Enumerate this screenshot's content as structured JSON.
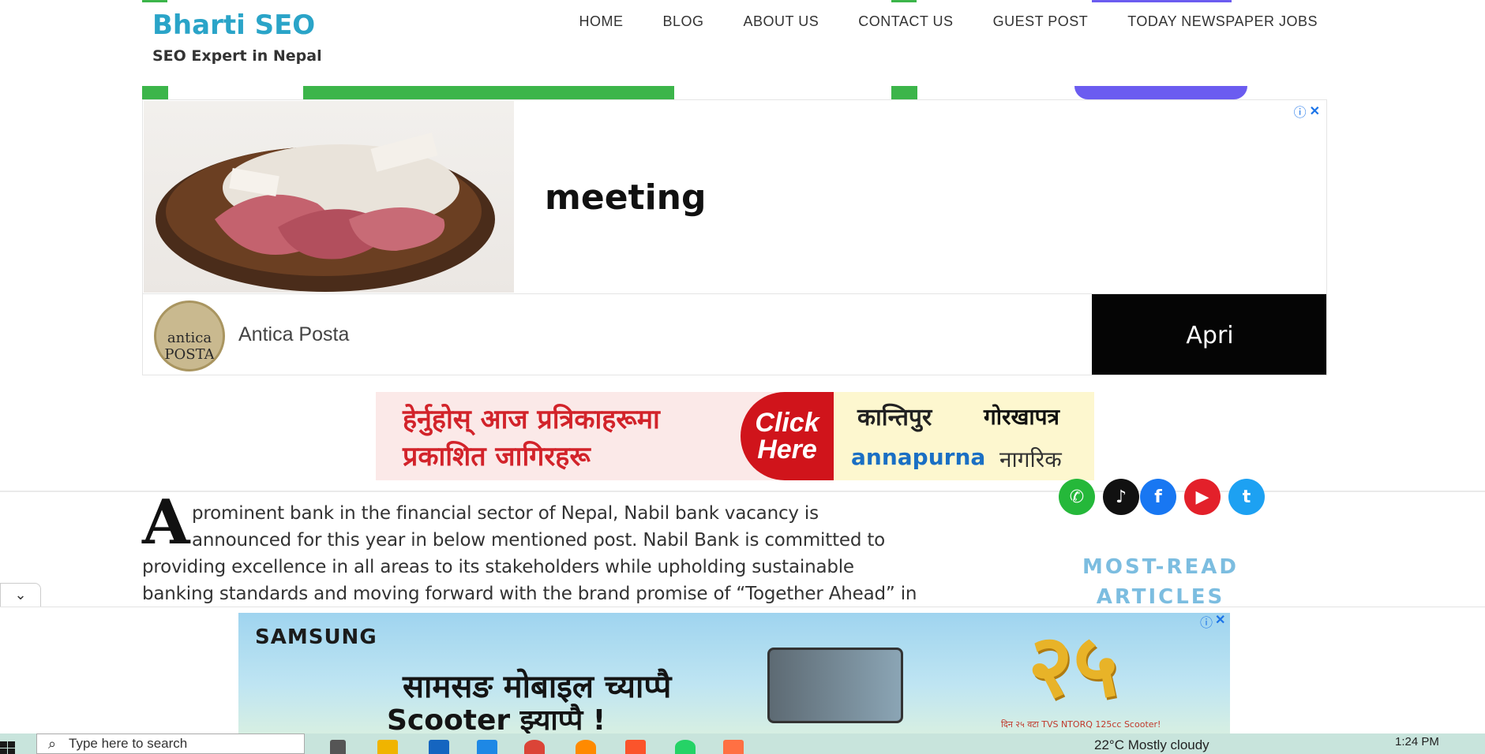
{
  "header": {
    "site_title": "Bharti SEO",
    "tagline": "SEO Expert in Nepal",
    "nav": [
      "HOME",
      "BLOG",
      "ABOUT US",
      "CONTACT US",
      "GUEST POST",
      "TODAY NEWSPAPER JOBS"
    ]
  },
  "top_ad": {
    "headline": "meeting",
    "advertiser": "Antica Posta",
    "cta": "Apri",
    "logo_text": "antica POSTA"
  },
  "jobs_banner": {
    "line1": "हेर्नुहोस् आज प्रत्रिकाहरूमा",
    "line2": "प्रकाशित जागिरहरू",
    "click1": "Click",
    "click2": "Here",
    "papers": [
      "कान्तिपुर",
      "गोरखापत्र",
      "annapurna",
      "नागरिक"
    ]
  },
  "article": {
    "dropcap": "A",
    "lines": [
      "prominent bank in the financial sector of Nepal, Nabil bank vacancy is",
      "announced for this year in below mentioned post. Nabil Bank is committed to",
      "providing excellence in all areas to its stakeholders while upholding sustainable",
      "banking standards and moving forward with the brand promise of “Together Ahead” in"
    ]
  },
  "sidebar": {
    "most_read": "MOST-READ ARTICLES"
  },
  "bottom_ad": {
    "brand": "SAMSUNG",
    "line1": "सामसङ मोबाइल च्याप्पै",
    "line2": "Scooter झ्याप्पै !",
    "badge": "२५",
    "small_print": "दिन २५ वटा TVS NTORQ 125cc Scooter!"
  },
  "taskbar": {
    "search_placeholder": "Type here to search",
    "weather": "22°C  Mostly cloudy",
    "clock": "1:24 PM"
  },
  "colors": {
    "brand": "#2aa4c8",
    "accent_green": "#3cb54a",
    "jobs_red": "#d2232a",
    "most_read": "#7cbde0"
  }
}
